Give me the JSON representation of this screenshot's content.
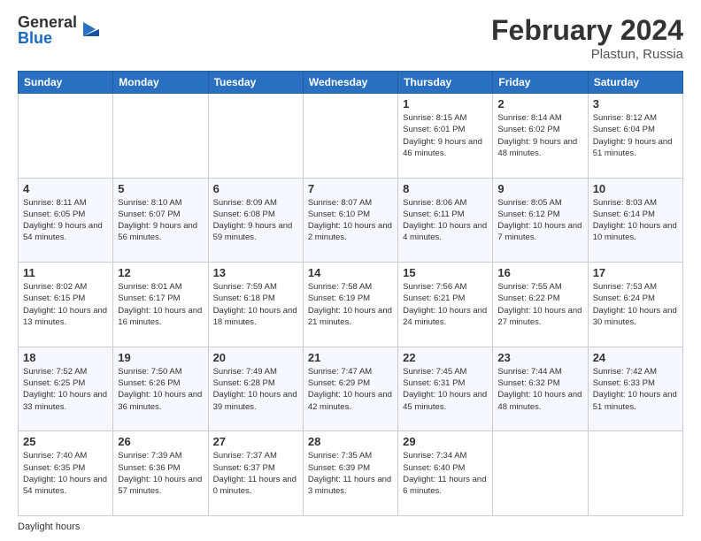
{
  "logo": {
    "general": "General",
    "blue": "Blue"
  },
  "header": {
    "title": "February 2024",
    "subtitle": "Plastun, Russia"
  },
  "days_of_week": [
    "Sunday",
    "Monday",
    "Tuesday",
    "Wednesday",
    "Thursday",
    "Friday",
    "Saturday"
  ],
  "footer": {
    "note": "Daylight hours"
  },
  "weeks": [
    {
      "cells": [
        {
          "day": "",
          "info": ""
        },
        {
          "day": "",
          "info": ""
        },
        {
          "day": "",
          "info": ""
        },
        {
          "day": "",
          "info": ""
        },
        {
          "day": "1",
          "info": "Sunrise: 8:15 AM\nSunset: 6:01 PM\nDaylight: 9 hours\nand 46 minutes."
        },
        {
          "day": "2",
          "info": "Sunrise: 8:14 AM\nSunset: 6:02 PM\nDaylight: 9 hours\nand 48 minutes."
        },
        {
          "day": "3",
          "info": "Sunrise: 8:12 AM\nSunset: 6:04 PM\nDaylight: 9 hours\nand 51 minutes."
        }
      ]
    },
    {
      "cells": [
        {
          "day": "4",
          "info": "Sunrise: 8:11 AM\nSunset: 6:05 PM\nDaylight: 9 hours\nand 54 minutes."
        },
        {
          "day": "5",
          "info": "Sunrise: 8:10 AM\nSunset: 6:07 PM\nDaylight: 9 hours\nand 56 minutes."
        },
        {
          "day": "6",
          "info": "Sunrise: 8:09 AM\nSunset: 6:08 PM\nDaylight: 9 hours\nand 59 minutes."
        },
        {
          "day": "7",
          "info": "Sunrise: 8:07 AM\nSunset: 6:10 PM\nDaylight: 10 hours\nand 2 minutes."
        },
        {
          "day": "8",
          "info": "Sunrise: 8:06 AM\nSunset: 6:11 PM\nDaylight: 10 hours\nand 4 minutes."
        },
        {
          "day": "9",
          "info": "Sunrise: 8:05 AM\nSunset: 6:12 PM\nDaylight: 10 hours\nand 7 minutes."
        },
        {
          "day": "10",
          "info": "Sunrise: 8:03 AM\nSunset: 6:14 PM\nDaylight: 10 hours\nand 10 minutes."
        }
      ]
    },
    {
      "cells": [
        {
          "day": "11",
          "info": "Sunrise: 8:02 AM\nSunset: 6:15 PM\nDaylight: 10 hours\nand 13 minutes."
        },
        {
          "day": "12",
          "info": "Sunrise: 8:01 AM\nSunset: 6:17 PM\nDaylight: 10 hours\nand 16 minutes."
        },
        {
          "day": "13",
          "info": "Sunrise: 7:59 AM\nSunset: 6:18 PM\nDaylight: 10 hours\nand 18 minutes."
        },
        {
          "day": "14",
          "info": "Sunrise: 7:58 AM\nSunset: 6:19 PM\nDaylight: 10 hours\nand 21 minutes."
        },
        {
          "day": "15",
          "info": "Sunrise: 7:56 AM\nSunset: 6:21 PM\nDaylight: 10 hours\nand 24 minutes."
        },
        {
          "day": "16",
          "info": "Sunrise: 7:55 AM\nSunset: 6:22 PM\nDaylight: 10 hours\nand 27 minutes."
        },
        {
          "day": "17",
          "info": "Sunrise: 7:53 AM\nSunset: 6:24 PM\nDaylight: 10 hours\nand 30 minutes."
        }
      ]
    },
    {
      "cells": [
        {
          "day": "18",
          "info": "Sunrise: 7:52 AM\nSunset: 6:25 PM\nDaylight: 10 hours\nand 33 minutes."
        },
        {
          "day": "19",
          "info": "Sunrise: 7:50 AM\nSunset: 6:26 PM\nDaylight: 10 hours\nand 36 minutes."
        },
        {
          "day": "20",
          "info": "Sunrise: 7:49 AM\nSunset: 6:28 PM\nDaylight: 10 hours\nand 39 minutes."
        },
        {
          "day": "21",
          "info": "Sunrise: 7:47 AM\nSunset: 6:29 PM\nDaylight: 10 hours\nand 42 minutes."
        },
        {
          "day": "22",
          "info": "Sunrise: 7:45 AM\nSunset: 6:31 PM\nDaylight: 10 hours\nand 45 minutes."
        },
        {
          "day": "23",
          "info": "Sunrise: 7:44 AM\nSunset: 6:32 PM\nDaylight: 10 hours\nand 48 minutes."
        },
        {
          "day": "24",
          "info": "Sunrise: 7:42 AM\nSunset: 6:33 PM\nDaylight: 10 hours\nand 51 minutes."
        }
      ]
    },
    {
      "cells": [
        {
          "day": "25",
          "info": "Sunrise: 7:40 AM\nSunset: 6:35 PM\nDaylight: 10 hours\nand 54 minutes."
        },
        {
          "day": "26",
          "info": "Sunrise: 7:39 AM\nSunset: 6:36 PM\nDaylight: 10 hours\nand 57 minutes."
        },
        {
          "day": "27",
          "info": "Sunrise: 7:37 AM\nSunset: 6:37 PM\nDaylight: 11 hours\nand 0 minutes."
        },
        {
          "day": "28",
          "info": "Sunrise: 7:35 AM\nSunset: 6:39 PM\nDaylight: 11 hours\nand 3 minutes."
        },
        {
          "day": "29",
          "info": "Sunrise: 7:34 AM\nSunset: 6:40 PM\nDaylight: 11 hours\nand 6 minutes."
        },
        {
          "day": "",
          "info": ""
        },
        {
          "day": "",
          "info": ""
        }
      ]
    }
  ]
}
